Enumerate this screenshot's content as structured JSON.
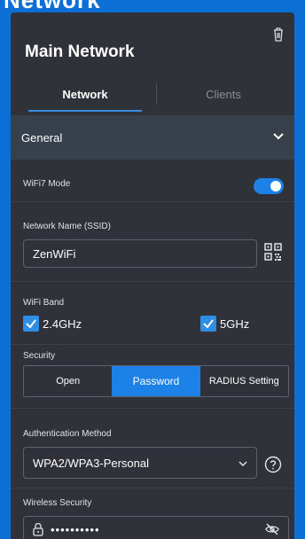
{
  "backdrop": {
    "peek_text": "Network"
  },
  "panel": {
    "title": "Main Network"
  },
  "tabs": [
    {
      "label": "Network",
      "active": true
    },
    {
      "label": "Clients",
      "active": false
    }
  ],
  "section": {
    "title": "General",
    "expanded": true
  },
  "wifi7": {
    "label": "WiFi7 Mode",
    "enabled": true
  },
  "ssid": {
    "label": "Network Name (SSID)",
    "value": "ZenWiFi"
  },
  "band": {
    "label": "WiFi Band",
    "options": [
      {
        "label": "2.4GHz",
        "checked": true
      },
      {
        "label": "5GHz",
        "checked": true
      }
    ]
  },
  "security": {
    "label": "Security",
    "options": [
      "Open",
      "Password",
      "RADIUS Setting"
    ],
    "selected": "Password"
  },
  "auth": {
    "label": "Authentication Method",
    "value": "WPA2/WPA3-Personal"
  },
  "wireless_security": {
    "label": "Wireless Security",
    "masked_value": "••••••••••"
  },
  "icons": {
    "trash": "trash-icon",
    "chevron": "chevron-down-icon",
    "qr": "qr-code-icon",
    "help": "help-icon",
    "lock": "lock-icon",
    "eye": "eye-off-icon"
  },
  "colors": {
    "accent": "#1d82e8",
    "panel": "#2f3238",
    "backdrop": "#0b6fd6"
  }
}
